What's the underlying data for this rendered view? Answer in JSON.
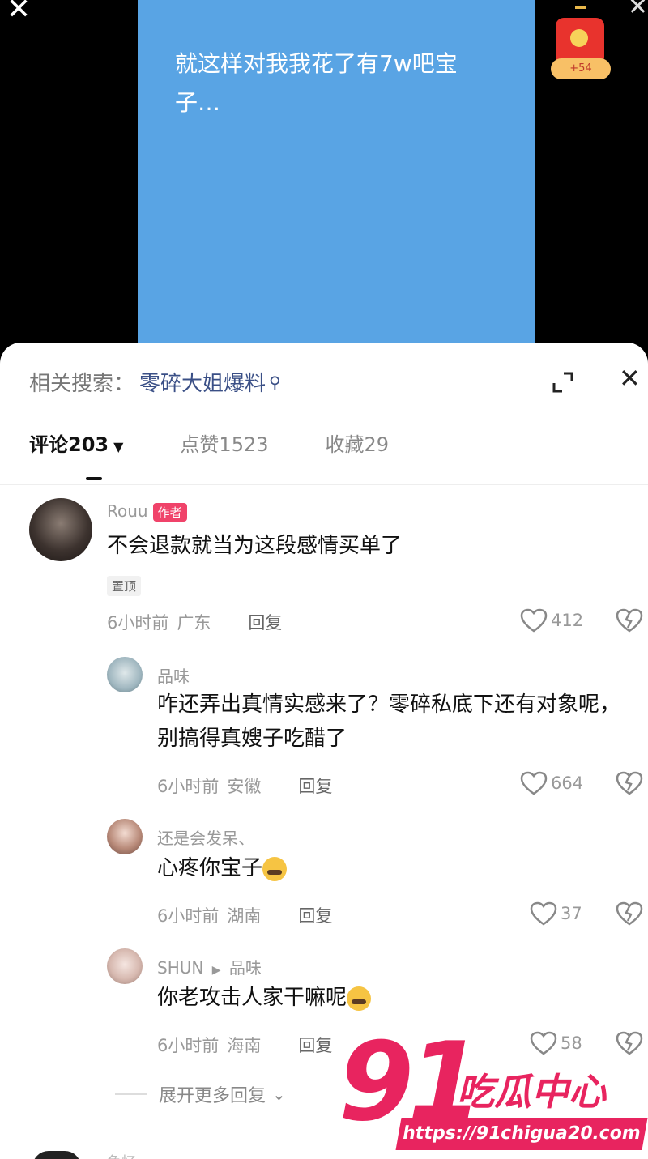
{
  "video": {
    "overlay_text": "就这样对我我花了有7w吧宝子…",
    "redpack_label": "+54",
    "close_glyph": "✕"
  },
  "search": {
    "label": "相关搜索：",
    "keyword": "零碎大姐爆料",
    "close_glyph": "✕"
  },
  "tabs": [
    {
      "label": "评论203",
      "active": true
    },
    {
      "label": "点赞1523",
      "active": false
    },
    {
      "label": "收藏29",
      "active": false
    }
  ],
  "comments": [
    {
      "user": "Rouu",
      "badge": "作者",
      "text": "不会退款就当为这段感情买单了",
      "pin": "置顶",
      "time": "6小时前",
      "region": "广东",
      "reply": "回复",
      "likes": "412"
    },
    {
      "user": "品味",
      "text": "咋还弄出真情实感来了？零碎私底下还有对象呢，别搞得真嫂子吃醋了",
      "time": "6小时前",
      "region": "安徽",
      "reply": "回复",
      "likes": "664"
    },
    {
      "user": "还是会发呆、",
      "text": "心疼你宝子",
      "time": "6小时前",
      "region": "湖南",
      "reply": "回复",
      "likes": "37"
    },
    {
      "user": "SHUN",
      "reply_to": "品味",
      "text": "你老攻击人家干嘛呢",
      "time": "6小时前",
      "region": "海南",
      "reply": "回复",
      "likes": "58"
    }
  ],
  "expand_more": "展开更多回复",
  "next_user": "鱼忆",
  "watermark": {
    "number": "91",
    "name": "吃瓜中心",
    "url": "https://91chigua20.com"
  }
}
